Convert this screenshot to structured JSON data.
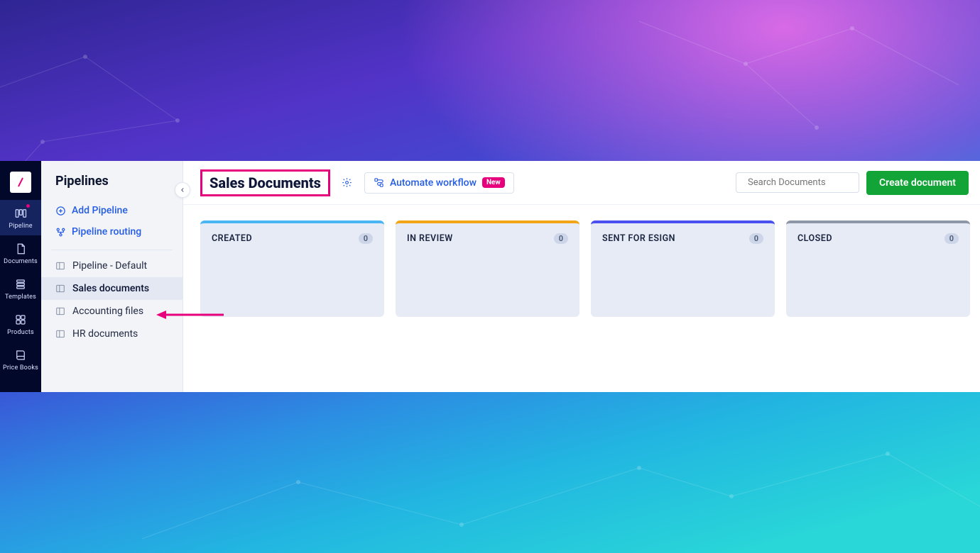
{
  "rail": {
    "items": [
      {
        "label": "Pipeline",
        "icon": "columns",
        "active": true,
        "dot": true
      },
      {
        "label": "Documents",
        "icon": "document",
        "active": false,
        "dot": false
      },
      {
        "label": "Templates",
        "icon": "stack",
        "active": false,
        "dot": false
      },
      {
        "label": "Products",
        "icon": "grid",
        "active": false,
        "dot": false
      },
      {
        "label": "Price Books",
        "icon": "book",
        "active": false,
        "dot": false
      }
    ]
  },
  "panel": {
    "title": "Pipelines",
    "add_label": "Add Pipeline",
    "routing_label": "Pipeline routing",
    "items": [
      {
        "label": "Pipeline - Default",
        "active": false
      },
      {
        "label": "Sales documents",
        "active": true
      },
      {
        "label": "Accounting files",
        "active": false
      },
      {
        "label": "HR documents",
        "active": false
      }
    ]
  },
  "toolbar": {
    "title": "Sales Documents",
    "automate_label": "Automate workflow",
    "automate_badge": "New",
    "search_placeholder": "Search Documents",
    "create_label": "Create document"
  },
  "board": {
    "columns": [
      {
        "title": "CREATED",
        "count": "0",
        "accent": "#4ab5f4"
      },
      {
        "title": "IN REVIEW",
        "count": "0",
        "accent": "#f2a516"
      },
      {
        "title": "SENT FOR ESIGN",
        "count": "0",
        "accent": "#4a4ff0"
      },
      {
        "title": "CLOSED",
        "count": "0",
        "accent": "#8e97a8"
      }
    ]
  }
}
